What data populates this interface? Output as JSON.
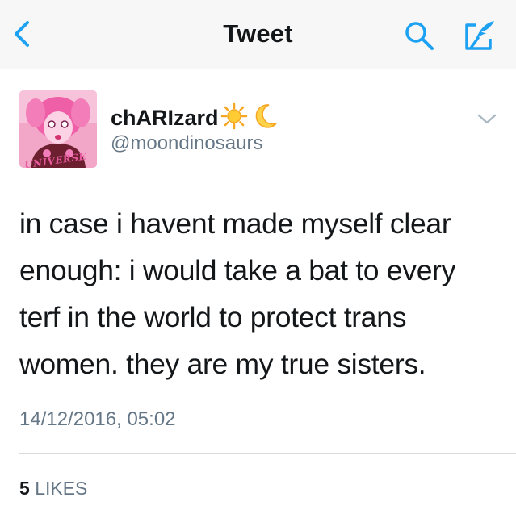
{
  "colors": {
    "accent": "#1da1f2",
    "nav_background": "#f7f7f7",
    "text_primary": "#14171a",
    "text_secondary": "#657786"
  },
  "nav": {
    "title": "Tweet",
    "back_icon": "chevron-left-icon",
    "search_icon": "search-icon",
    "compose_icon": "compose-icon"
  },
  "tweet": {
    "author": {
      "display_name": "chARIzard",
      "name_emojis": [
        "sun-emoji",
        "crescent-moon-emoji"
      ],
      "handle": "@moondinosaurs",
      "avatar_icon": "avatar-image",
      "avatar_caption": "UNIVERSE"
    },
    "text_lines": [
      "in case i havent made myself clear",
      "enough: i would take a bat to every",
      "terf in the world to protect trans",
      "women. they are my true sisters."
    ],
    "timestamp": "14/12/2016, 05:02",
    "likes_count": "5",
    "likes_label": "LIKES"
  }
}
